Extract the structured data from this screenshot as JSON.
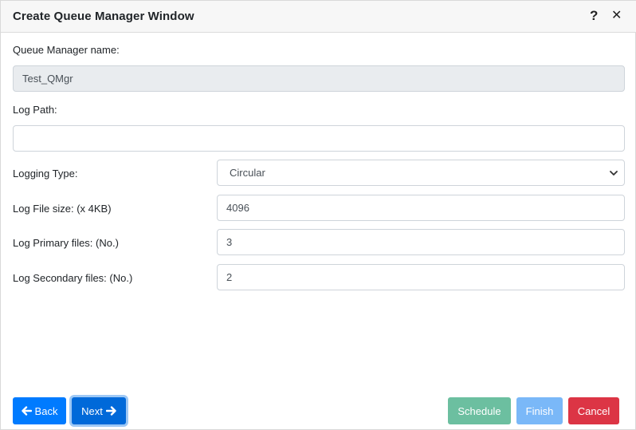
{
  "window": {
    "title": "Create Queue Manager Window",
    "help_icon": "?",
    "close_icon": "✕"
  },
  "form": {
    "qm_name_label": "Queue Manager name:",
    "qm_name_value": "Test_QMgr",
    "log_path_label": "Log Path:",
    "log_path_value": "",
    "logging_type_label": "Logging Type:",
    "logging_type_value": "Circular",
    "log_file_size_label": "Log File size: (x 4KB)",
    "log_file_size_value": "4096",
    "log_primary_label": "Log Primary files: (No.)",
    "log_primary_value": "3",
    "log_secondary_label": "Log Secondary files: (No.)",
    "log_secondary_value": "2"
  },
  "buttons": {
    "back": "Back",
    "next": "Next",
    "schedule": "Schedule",
    "finish": "Finish",
    "cancel": "Cancel"
  },
  "icons": {
    "back_icon": "arrow-left-icon",
    "next_icon": "arrow-right-icon",
    "select_icon": "chevron-down-icon"
  },
  "colors": {
    "primary": "#007bff",
    "schedule": "#6cbfa0",
    "finish": "#7ab8f8",
    "cancel": "#dc3545"
  }
}
